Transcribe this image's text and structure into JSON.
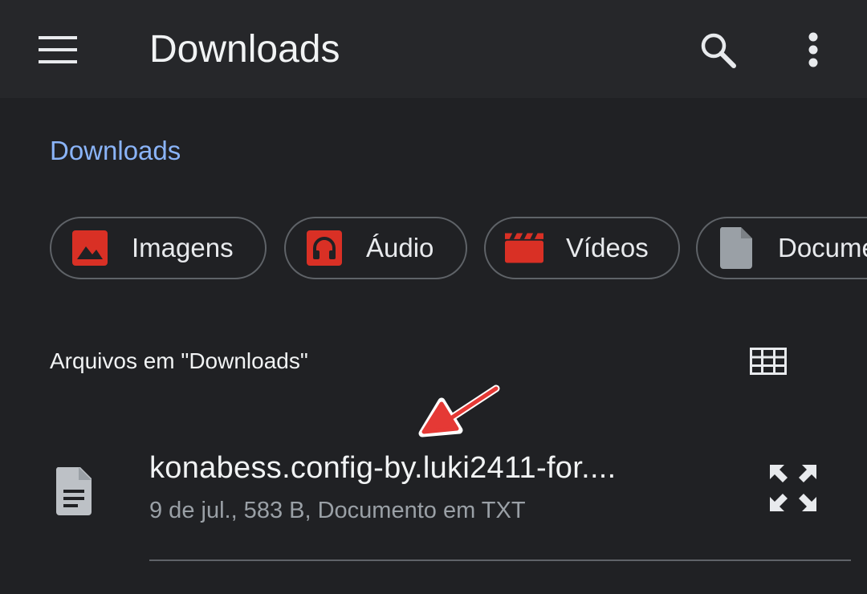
{
  "appbar": {
    "title": "Downloads",
    "menu_icon": "menu-icon",
    "search_icon": "search-icon",
    "more_icon": "more-vert-icon"
  },
  "breadcrumb": {
    "label": "Downloads",
    "color": "#8ab4f8"
  },
  "chips": [
    {
      "label": "Imagens",
      "icon": "image-icon",
      "color": "#d93025"
    },
    {
      "label": "Áudio",
      "icon": "headphones-icon",
      "color": "#d93025"
    },
    {
      "label": "Vídeos",
      "icon": "movie-icon",
      "color": "#d93025"
    },
    {
      "label": "Documentos",
      "icon": "document-icon",
      "color": "#9aa0a6"
    }
  ],
  "section": {
    "title": "Arquivos em \"Downloads\"",
    "view_toggle_icon": "grid-view-icon"
  },
  "files": [
    {
      "name": "konabess.config-by.luki2411-for....",
      "meta": "9 de jul., 583 B, Documento em TXT",
      "icon": "text-document-icon",
      "action_icon": "expand-icon"
    }
  ],
  "annotation": {
    "icon": "red-arrow-icon",
    "color": "#e53935"
  }
}
